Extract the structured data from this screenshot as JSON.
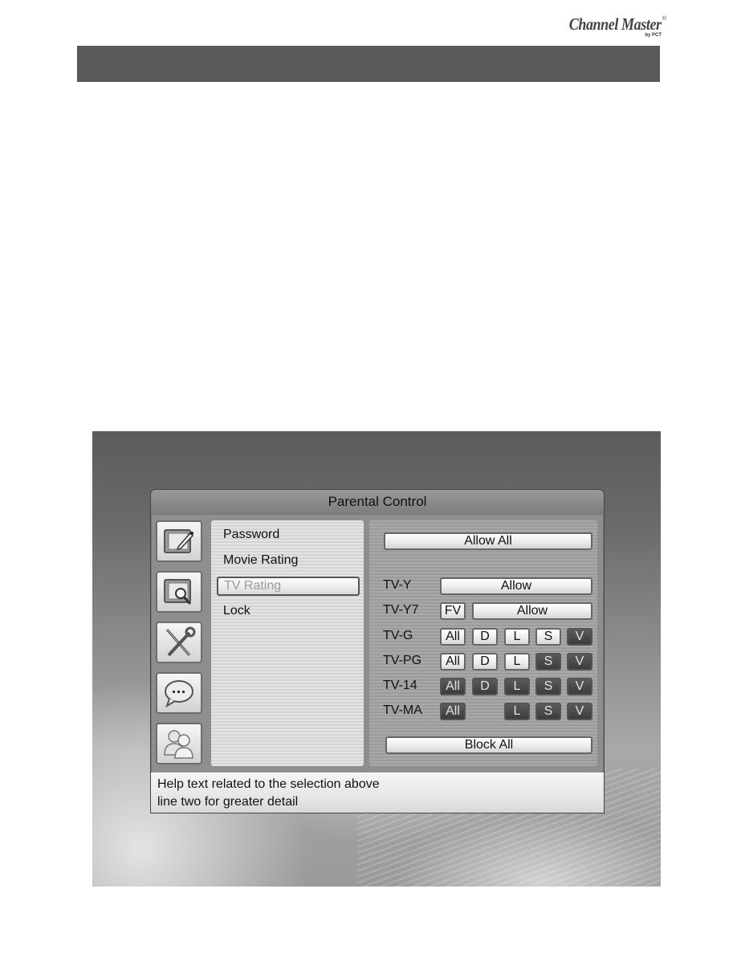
{
  "brand": {
    "name": "Channel Master",
    "registered": "®",
    "sub": "by PCT"
  },
  "dialog": {
    "title": "Parental Control",
    "side_icons": [
      {
        "name": "tv-edit-icon"
      },
      {
        "name": "tv-search-icon"
      },
      {
        "name": "tools-icon"
      },
      {
        "name": "chat-bubble-icon"
      },
      {
        "name": "users-icon"
      }
    ],
    "menu": {
      "items": [
        {
          "label": "Password",
          "selected": false
        },
        {
          "label": "Movie Rating",
          "selected": false
        },
        {
          "label": "TV Rating",
          "selected": true
        },
        {
          "label": "Lock",
          "selected": false
        }
      ]
    },
    "ratings": {
      "allow_all_label": "Allow All",
      "block_all_label": "Block All",
      "rows": [
        {
          "label": "TV-Y",
          "allow_label": "Allow"
        },
        {
          "label": "TV-Y7",
          "fv": {
            "label": "FV",
            "state": "on"
          },
          "allow_label": "Allow"
        },
        {
          "label": "TV-G",
          "chips": [
            {
              "label": "All",
              "state": "on"
            },
            {
              "label": "D",
              "state": "on"
            },
            {
              "label": "L",
              "state": "on"
            },
            {
              "label": "S",
              "state": "on"
            },
            {
              "label": "V",
              "state": "off"
            }
          ]
        },
        {
          "label": "TV-PG",
          "chips": [
            {
              "label": "All",
              "state": "on"
            },
            {
              "label": "D",
              "state": "on"
            },
            {
              "label": "L",
              "state": "on"
            },
            {
              "label": "S",
              "state": "off"
            },
            {
              "label": "V",
              "state": "off"
            }
          ]
        },
        {
          "label": "TV-14",
          "chips": [
            {
              "label": "All",
              "state": "off"
            },
            {
              "label": "D",
              "state": "off"
            },
            {
              "label": "L",
              "state": "off"
            },
            {
              "label": "S",
              "state": "off"
            },
            {
              "label": "V",
              "state": "off"
            }
          ]
        },
        {
          "label": "TV-MA",
          "chips": [
            {
              "label": "All",
              "state": "off"
            },
            {
              "label": "L",
              "state": "off"
            },
            {
              "label": "S",
              "state": "off"
            },
            {
              "label": "V",
              "state": "off"
            }
          ]
        }
      ]
    },
    "help": {
      "line1": "Help text related to the selection above",
      "line2": "line two for greater detail"
    }
  }
}
